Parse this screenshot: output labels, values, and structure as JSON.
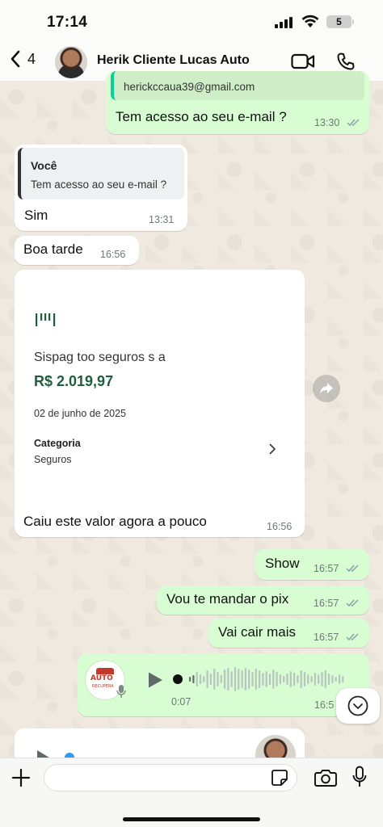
{
  "status_bar": {
    "time": "17:14",
    "battery": "5"
  },
  "header": {
    "back_count": "4",
    "contact_name": "Herik Cliente Lucas Auto"
  },
  "messages": [
    {
      "type": "outgoing",
      "quoted_email": "herickccaua39@gmail.com",
      "text": "Tem acesso ao seu e-mail ?",
      "time": "13:30",
      "read": true
    },
    {
      "type": "incoming",
      "quote_author": "Você",
      "quote_text": "Tem acesso ao seu e-mail ?",
      "text": "Sim",
      "time": "13:31"
    },
    {
      "type": "incoming",
      "text": "Boa tarde",
      "time": "16:56"
    },
    {
      "type": "incoming_card",
      "card": {
        "title": "Sispag  too seguros s a",
        "amount": "R$ 2.019,97",
        "date": "02 de junho de 2025",
        "category_label": "Categoria",
        "category_value": "Seguros"
      },
      "text": "Caiu este valor agora a pouco",
      "time": "16:56"
    },
    {
      "type": "outgoing",
      "text": "Show",
      "time": "16:57",
      "read": true
    },
    {
      "type": "outgoing",
      "text": "Vou te mandar o pix",
      "time": "16:57",
      "read": true
    },
    {
      "type": "outgoing",
      "text": "Vai cair mais",
      "time": "16:57",
      "read": true
    },
    {
      "type": "outgoing_audio",
      "avatar_text": "AUTO",
      "avatar_subtext": "RECUPERA",
      "duration": "0:07",
      "time": "16:5"
    }
  ],
  "input": {
    "placeholder": ""
  },
  "colors": {
    "outgoing": "#d9fdd3",
    "incoming": "#ffffff",
    "amount": "#1f5e3d",
    "read_ticks": "#8aa0a8"
  }
}
